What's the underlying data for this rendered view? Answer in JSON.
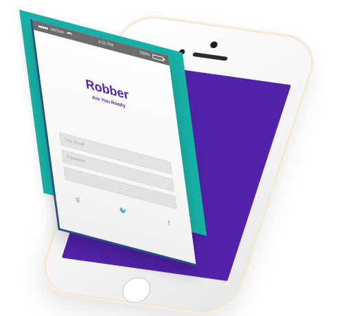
{
  "phone": {
    "screen_color": "#5222a8",
    "teal_color": "#19b1a7"
  },
  "status_bar": {
    "carrier": "Verizon",
    "time": "4:21 PM",
    "battery": "100%"
  },
  "app": {
    "title": "Robber",
    "subtitle": "Are You Ready",
    "email_placeholder": "Your Email",
    "password_placeholder": "Password",
    "login_label": "→",
    "social_icons": [
      "google",
      "twitter",
      "facebook"
    ]
  }
}
